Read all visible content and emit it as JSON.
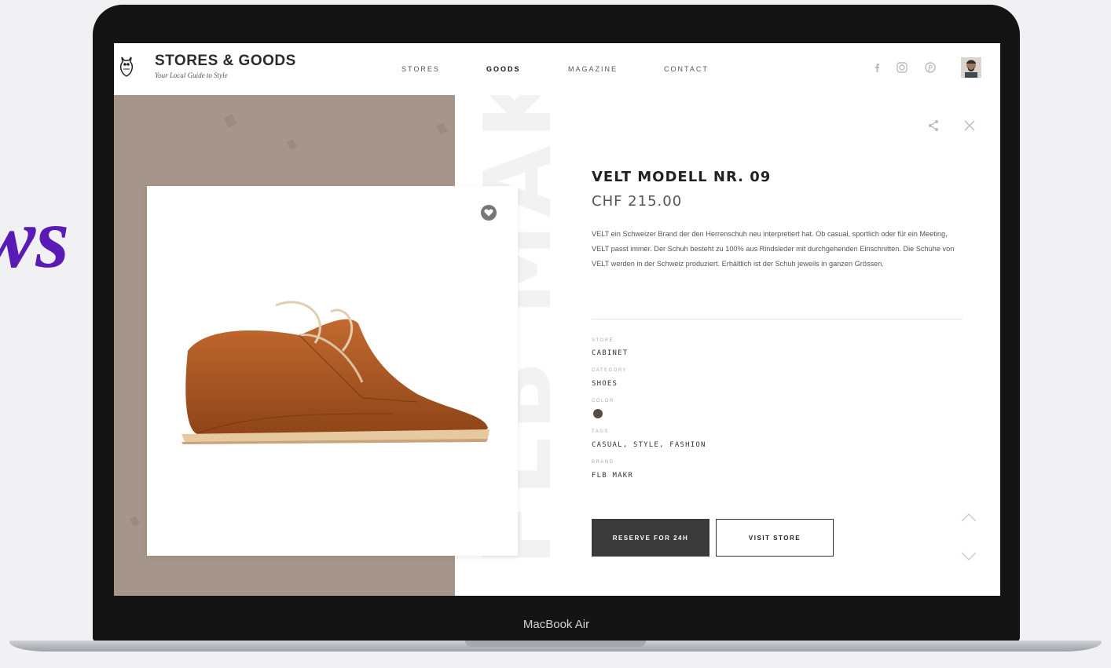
{
  "background_text": "ws",
  "device": {
    "label": "MacBook Air"
  },
  "header": {
    "brand": {
      "name": "STORES & GOODS",
      "tagline": "Your Local Guide to Style"
    },
    "nav": [
      {
        "label": "STORES",
        "active": false
      },
      {
        "label": "GOODS",
        "active": true
      },
      {
        "label": "MAGAZINE",
        "active": false
      },
      {
        "label": "CONTACT",
        "active": false
      }
    ],
    "social_icons": [
      "facebook-icon",
      "instagram-icon",
      "pinterest-icon"
    ],
    "avatar": "user-avatar"
  },
  "product": {
    "watermark": "FLB MAKR",
    "title": "VELT MODELL NR. 09",
    "price": "CHF 215.00",
    "description": "VELT ein Schweizer Brand der den Herrenschuh neu interpretiert hat. Ob casual, sportlich oder für ein Meeting, VELT passt immer. Der Schuh besteht zu 100% aus Rindsleder mit durchgehenden Einschnitten. Die Schuhe von VELT werden in der Schweiz produziert. Erhältlich ist der Schuh jeweils in ganzen Grössen.",
    "meta": {
      "store_label": "STORE",
      "store_value": "CABINET",
      "category_label": "CATEGORY",
      "category_value": "SHOES",
      "color_label": "COLOR",
      "color_value": "#5b4a3e",
      "tags_label": "TAGS",
      "tags_value": "CASUAL, STYLE, FASHION",
      "brand_label": "BRAND",
      "brand_value": "FLB MAKR"
    },
    "buttons": {
      "reserve": "RESERVE FOR 24H",
      "visit": "VISIT STORE"
    }
  },
  "colors": {
    "panel": "#a5958b",
    "accent_dark": "#3a3a3a",
    "bg_word": "#5a1ab5"
  }
}
